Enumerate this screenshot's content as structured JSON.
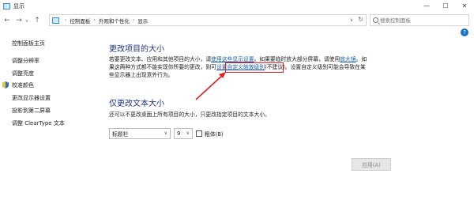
{
  "window": {
    "title": "显示",
    "controls": {
      "minimize": "—",
      "maximize": "☐",
      "close": "✕"
    }
  },
  "nav": {
    "back": "←",
    "forward": "→",
    "recent": "∨",
    "up": "↑",
    "breadcrumb": [
      "控制面板",
      "外观和个性化",
      "显示"
    ],
    "search_placeholder": "搜索控制面板"
  },
  "help_glyph": "?",
  "sidebar": {
    "items": [
      {
        "label": "控制面板主页"
      },
      {
        "label": "调整分辨率"
      },
      {
        "label": "调整亮度"
      },
      {
        "label": "校准颜色"
      },
      {
        "label": "更改显示器设置"
      },
      {
        "label": "投影到第二屏幕"
      },
      {
        "label": "调整 ClearType 文本"
      }
    ]
  },
  "section1": {
    "title": "更改项目的大小",
    "line1_a": "若要更改文本、应用和其他项目的大小，请",
    "line1_link1": "使用这些显示设置",
    "line1_b": "。如果要临时放大部分屏幕，请使用",
    "line1_link2": "放大镜",
    "line1_c": "。如",
    "line2_a": "果这两种方式都不能实现你所要的更改，则可",
    "line2_link": "设置自定义缩放级别",
    "line2_b": "(不建议)。设置自定义级别可能会导致在某",
    "line3": "些显示器上出现意外行为。"
  },
  "section2": {
    "title": "仅更改文本大小",
    "desc": "还可以不更改桌面上所有项目的大小，只更改指定项目的文本大小。",
    "element_select": "标题栏",
    "size_select": "9",
    "dropdown_glyph": "∨",
    "bold_label": "粗体(B)",
    "bold_checked": false
  },
  "apply_button": "应用(A)",
  "colors": {
    "heading": "#1e3287",
    "link": "#1a5fb4",
    "highlight": "#e02020"
  }
}
